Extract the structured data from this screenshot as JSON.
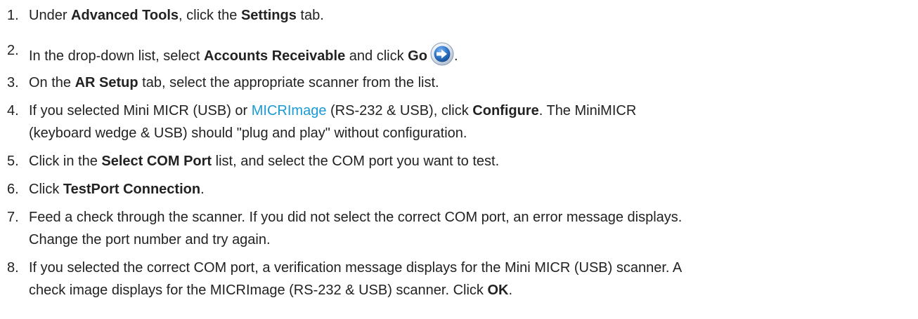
{
  "steps": [
    {
      "num": "1.",
      "lines": [
        {
          "parts": [
            "Under ",
            "Advanced Tools",
            ", click the ",
            "Settings",
            " tab."
          ]
        }
      ]
    },
    {
      "num": "2.",
      "lines": [
        {
          "parts": [
            "In the drop-down list, select ",
            "Accounts Receivable",
            " and click ",
            "Go",
            "."
          ]
        }
      ],
      "icon": "go-arrow-icon"
    },
    {
      "num": "3.",
      "lines": [
        {
          "parts": [
            "On the ",
            "AR Setup",
            " tab, select the appropriate scanner from the list."
          ]
        }
      ]
    },
    {
      "num": "4.",
      "lines": [
        {
          "parts": [
            "If you selected Mini MICR (USB) or ",
            "MICRImage",
            " (RS-232 & USB), click ",
            "Configure",
            ". The MiniMICR"
          ]
        },
        {
          "parts": [
            "(keyboard wedge & USB) should \"plug and play\" without configuration."
          ]
        }
      ]
    },
    {
      "num": "5.",
      "lines": [
        {
          "parts": [
            "Click in the ",
            "Select COM Port",
            " list, and select the COM port you want to test."
          ]
        }
      ]
    },
    {
      "num": "6.",
      "lines": [
        {
          "parts": [
            "Click ",
            "TestPort Connection",
            "."
          ]
        }
      ]
    },
    {
      "num": "7.",
      "lines": [
        {
          "parts": [
            "Feed a check through the scanner. If you did not select the correct COM port, an error message displays."
          ]
        },
        {
          "parts": [
            "Change the port number and try again."
          ]
        }
      ]
    },
    {
      "num": "8.",
      "lines": [
        {
          "parts": [
            "If you selected the correct COM port, a verification message displays for the Mini MICR (USB) scanner. A"
          ]
        },
        {
          "parts": [
            "check image displays for the MICRImage (RS-232 & USB) scanner. Click ",
            "OK",
            "."
          ]
        }
      ]
    }
  ],
  "colors": {
    "text": "#222222",
    "link": "#1a9bd7",
    "icon_blue": "#2f74c8"
  }
}
